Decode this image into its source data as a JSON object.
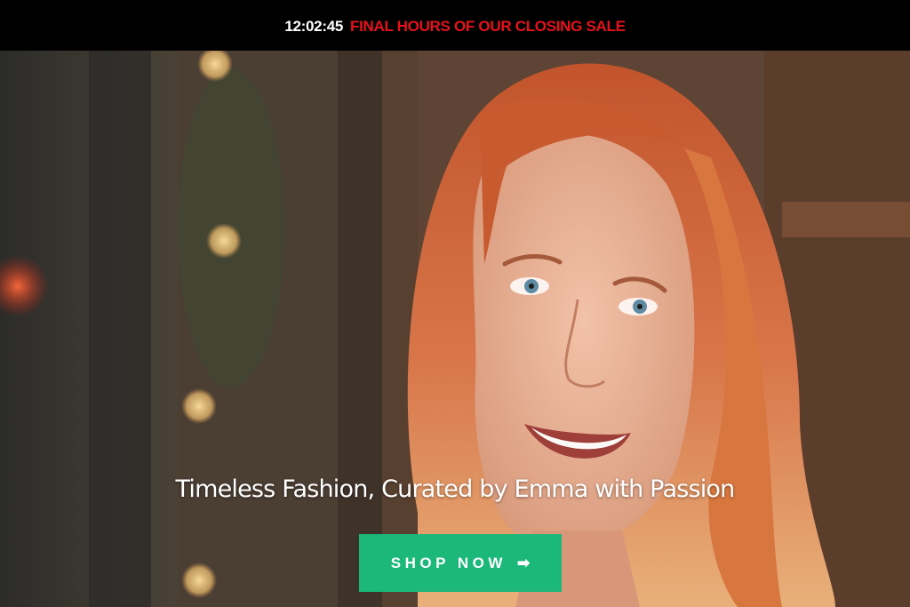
{
  "announcement": {
    "countdown": "12:02:45",
    "message": "FINAL HOURS OF OUR CLOSING SALE",
    "countdown_color": "#ffffff",
    "message_color": "#e8111b"
  },
  "hero": {
    "image_icon": "woman-portrait-photo",
    "tagline": "Timeless Fashion, Curated by Emma with Passion",
    "cta": {
      "label": "SHOP NOW",
      "icon": "arrow-right-icon",
      "color": "#1bb87a"
    }
  }
}
